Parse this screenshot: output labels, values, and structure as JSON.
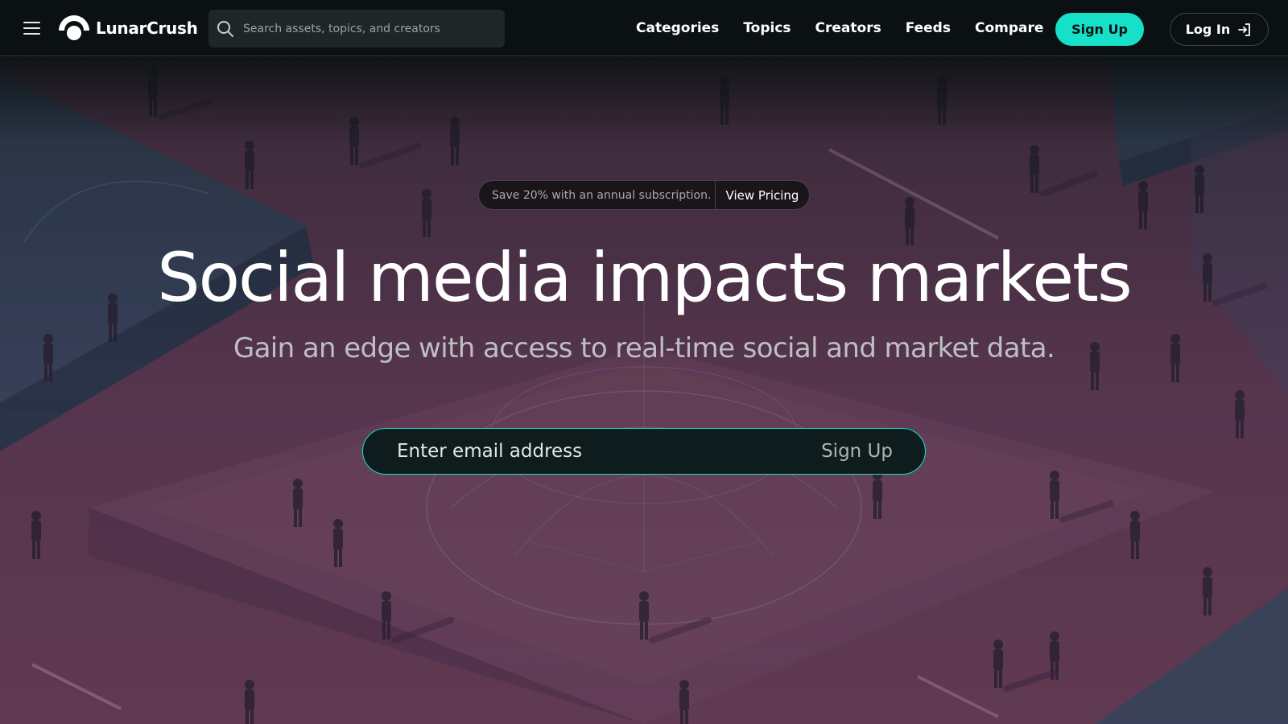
{
  "brand": {
    "name": "LunarCrush"
  },
  "search": {
    "placeholder": "Search assets, topics, and creators"
  },
  "nav": {
    "items": [
      {
        "label": "Categories"
      },
      {
        "label": "Topics"
      },
      {
        "label": "Creators"
      },
      {
        "label": "Feeds"
      },
      {
        "label": "Compare"
      }
    ],
    "signup_label": "Sign Up",
    "login_label": "Log In"
  },
  "promo": {
    "text": "Save 20% with an annual subscription.",
    "link_label": "View Pricing"
  },
  "hero": {
    "title": "Social media impacts markets",
    "subtitle": "Gain an edge with access to real-time social and market data."
  },
  "email_form": {
    "placeholder": "Enter email address",
    "submit_label": "Sign Up"
  },
  "colors": {
    "accent": "#17e0c8",
    "nav_bg": "#0b1113",
    "hero_floor": "#5c3a52",
    "hero_raised": "#3b4a63"
  },
  "icons": {
    "menu": "hamburger-icon",
    "logo": "moon-logo-icon",
    "search": "search-icon",
    "login": "login-icon"
  }
}
